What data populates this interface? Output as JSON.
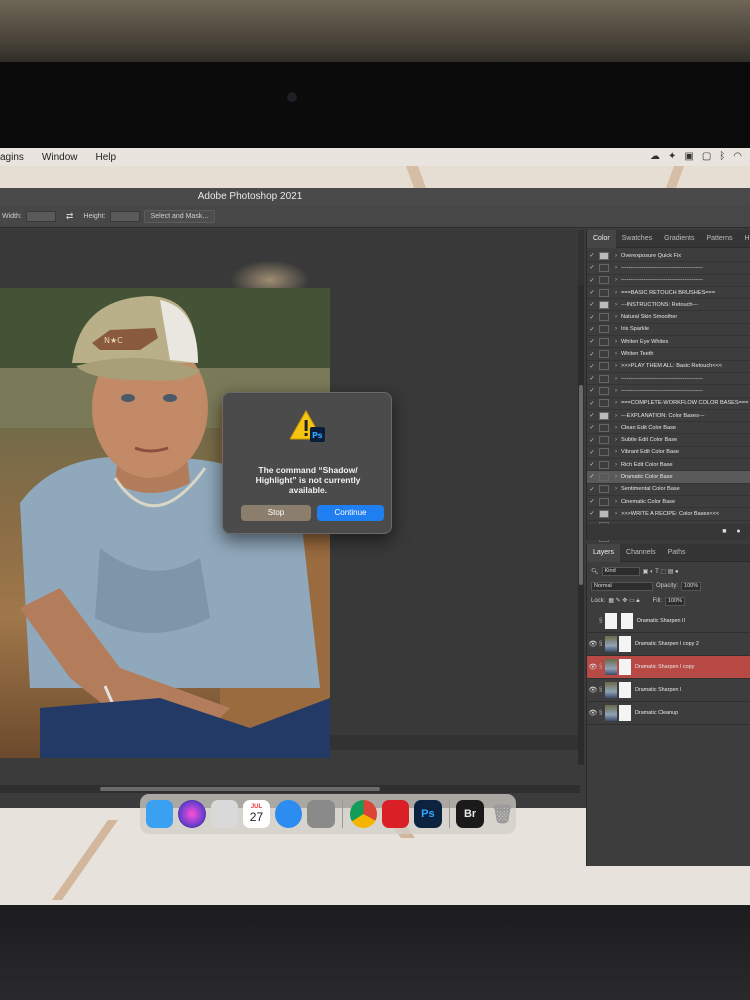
{
  "menubar": {
    "items": [
      "Plugins",
      "Window",
      "Help"
    ],
    "items_visible": [
      "agins",
      "Window",
      "Help"
    ]
  },
  "window": {
    "title": "Adobe Photoshop 2021"
  },
  "options_bar": {
    "width_label": "Width:",
    "height_label": "Height:",
    "select_mask_label": "Select and Mask..."
  },
  "dialog": {
    "message": "The command “Shadow/ Highlight” is not currently available.",
    "stop_label": "Stop",
    "continue_label": "Continue",
    "badge": "Ps"
  },
  "actions_panel": {
    "tabs": [
      "Color",
      "Swatches",
      "Gradients",
      "Patterns",
      "History"
    ],
    "active_tab": "Color",
    "items": [
      {
        "label": "Overexposure Quick Fix",
        "dialog": true,
        "selected": false
      },
      {
        "label": "--------------------------------------------",
        "dialog": false,
        "selected": false
      },
      {
        "label": "--------------------------------------------",
        "dialog": false,
        "selected": false
      },
      {
        "label": "===BASIC RETOUCH BRUSHES===",
        "dialog": false,
        "selected": false
      },
      {
        "label": "---INSTRUCTIONS: Retouch---",
        "dialog": true,
        "selected": false
      },
      {
        "label": "Natural Skin Smoother",
        "dialog": false,
        "selected": false
      },
      {
        "label": "Iris Sparkle",
        "dialog": false,
        "selected": false
      },
      {
        "label": "Whiten Eye Whites",
        "dialog": false,
        "selected": false
      },
      {
        "label": "Whiten Teeth",
        "dialog": false,
        "selected": false
      },
      {
        "label": ">>>PLAY THEM ALL: Basic Retouch<<<",
        "dialog": false,
        "selected": false
      },
      {
        "label": "--------------------------------------------",
        "dialog": false,
        "selected": false
      },
      {
        "label": "--------------------------------------------",
        "dialog": false,
        "selected": false
      },
      {
        "label": "===COMPLETE-WORKFLOW COLOR BASES===",
        "dialog": false,
        "selected": false
      },
      {
        "label": "---EXPLANATION: Color Bases---",
        "dialog": true,
        "selected": false
      },
      {
        "label": "Clean Edit Color Base",
        "dialog": false,
        "selected": false
      },
      {
        "label": "Subtle Edit Color Base",
        "dialog": false,
        "selected": false
      },
      {
        "label": "Vibrant Edit Color Base",
        "dialog": false,
        "selected": false
      },
      {
        "label": "Rich Edit Color Base",
        "dialog": false,
        "selected": false
      },
      {
        "label": "Dramatic Color Base",
        "dialog": false,
        "selected": true
      },
      {
        "label": "Sentimental Color Base",
        "dialog": false,
        "selected": false
      },
      {
        "label": "Cinematic Color Base",
        "dialog": false,
        "selected": false
      },
      {
        "label": ">>>WRITE A RECIPE: Color Bases<<<",
        "dialog": true,
        "selected": false
      },
      {
        "label": "--------------------------------------------",
        "dialog": false,
        "selected": false
      },
      {
        "label": "--------------------------------------------",
        "dialog": false,
        "selected": false
      }
    ]
  },
  "layers_panel": {
    "tabs": [
      "Layers",
      "Channels",
      "Paths"
    ],
    "active_tab": "Layers",
    "kind_label": "Kind",
    "blend_mode": "Normal",
    "opacity_label": "Opacity:",
    "opacity_value": "100%",
    "lock_label": "Lock:",
    "fill_label": "Fill:",
    "fill_value": "100%",
    "layers": [
      {
        "name": "Dramatic Sharpen II",
        "visible": false,
        "selected": false,
        "thumb": "mask"
      },
      {
        "name": "Dramatic Sharpen I copy 2",
        "visible": true,
        "selected": false,
        "thumb": "photo"
      },
      {
        "name": "Dramatic Sharpen I copy",
        "visible": true,
        "selected": true,
        "thumb": "photo"
      },
      {
        "name": "Dramatic Sharpen I",
        "visible": true,
        "selected": false,
        "thumb": "photo"
      },
      {
        "name": "Dramatic Cleanup",
        "visible": true,
        "selected": false,
        "thumb": "photo"
      }
    ]
  },
  "dock": {
    "apps": [
      {
        "name": "finder",
        "color": "#3aa0f2"
      },
      {
        "name": "siri",
        "color": "#6a3fd0"
      },
      {
        "name": "launchpad",
        "color": "#d9d9d9"
      },
      {
        "name": "calendar",
        "color": "#ffffff",
        "month": "JUL",
        "day": "27"
      },
      {
        "name": "safari",
        "color": "#2d8cf0"
      },
      {
        "name": "system-preferences",
        "color": "#8a8a8a"
      },
      {
        "name": "chrome",
        "color": "#e9e9e9"
      },
      {
        "name": "creative-cloud",
        "color": "#da1f26"
      },
      {
        "name": "photoshop",
        "color": "#0c2340",
        "label": "Ps"
      },
      {
        "name": "bridge",
        "color": "#1a1a1a",
        "label": "Br"
      },
      {
        "name": "trash",
        "color": "#bfbfbf"
      }
    ]
  },
  "photo": {
    "cap_patch_text": "N★C"
  }
}
